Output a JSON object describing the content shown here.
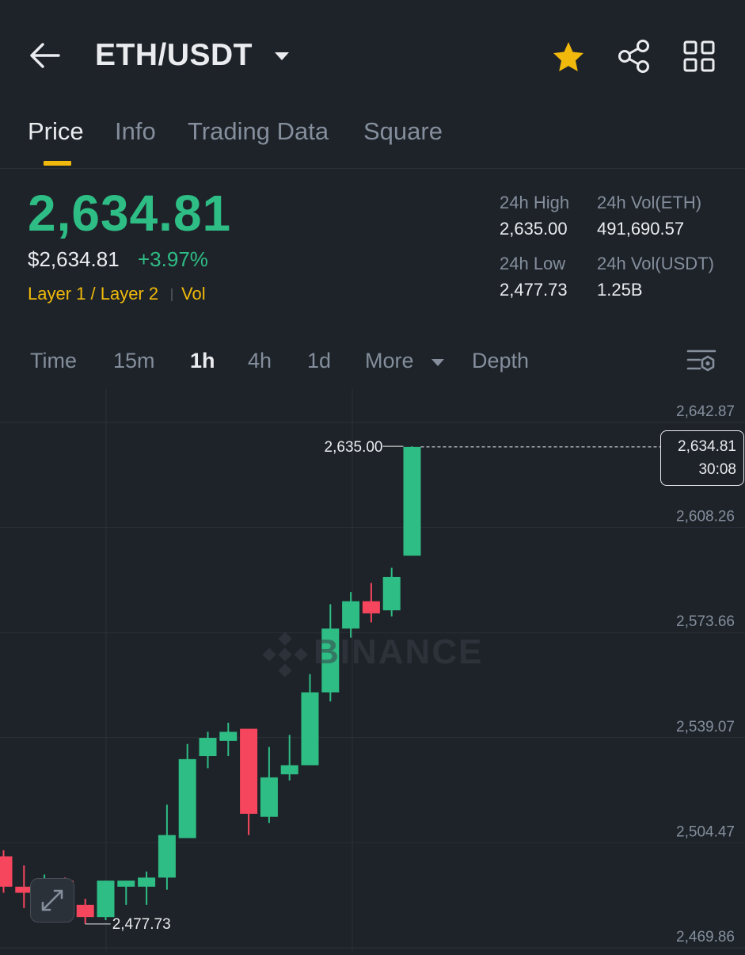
{
  "header": {
    "pair": "ETH/USDT",
    "icons": [
      "back-arrow",
      "caret-down",
      "star-favorite",
      "share",
      "grid-menu"
    ],
    "favorite_color": "#f0b90b"
  },
  "tabs": [
    {
      "label": "Price",
      "active": true
    },
    {
      "label": "Info",
      "active": false
    },
    {
      "label": "Trading Data",
      "active": false
    },
    {
      "label": "Square",
      "active": false
    }
  ],
  "price": {
    "last": "2,634.81",
    "usd": "$2,634.81",
    "change": "+3.97%",
    "tag1": "Layer 1 / Layer 2",
    "tag2": "Vol",
    "up_color": "#2ebd85",
    "down_color": "#f6465d"
  },
  "stats": {
    "high_label": "24h High",
    "high_value": "2,635.00",
    "low_label": "24h Low",
    "low_value": "2,477.73",
    "vol_base_label": "24h Vol(ETH)",
    "vol_base_value": "491,690.57",
    "vol_quote_label": "24h Vol(USDT)",
    "vol_quote_value": "1.25B"
  },
  "intervals": [
    {
      "label": "Time",
      "active": false
    },
    {
      "label": "15m",
      "active": false
    },
    {
      "label": "1h",
      "active": true
    },
    {
      "label": "4h",
      "active": false
    },
    {
      "label": "1d",
      "active": false
    },
    {
      "label": "More",
      "active": false
    },
    {
      "label": "Depth",
      "active": false
    }
  ],
  "chart_data": {
    "type": "candlestick",
    "interval": "1h",
    "y_ticks": [
      "2,642.87",
      "2,608.26",
      "2,573.66",
      "2,539.07",
      "2,504.47",
      "2,469.86"
    ],
    "ylim": [
      2469.86,
      2642.87
    ],
    "grid": true,
    "watermark": "BINANCE",
    "high_marker": "2,635.00",
    "low_marker": "2,477.73",
    "current_price": "2,634.81",
    "countdown": "30:08",
    "candles": [
      {
        "o": 2500.0,
        "h": 2502.0,
        "l": 2488.0,
        "c": 2490.0
      },
      {
        "o": 2490.0,
        "h": 2497.0,
        "l": 2483.0,
        "c": 2488.0
      },
      {
        "o": 2488.0,
        "h": 2494.0,
        "l": 2487.0,
        "c": 2492.0
      },
      {
        "o": 2492.0,
        "h": 2493.0,
        "l": 2481.0,
        "c": 2484.0
      },
      {
        "o": 2484.0,
        "h": 2486.0,
        "l": 2477.73,
        "c": 2480.0
      },
      {
        "o": 2480.0,
        "h": 2492.0,
        "l": 2479.0,
        "c": 2492.0
      },
      {
        "o": 2490.0,
        "h": 2492.0,
        "l": 2484.0,
        "c": 2492.0
      },
      {
        "o": 2490.0,
        "h": 2495.0,
        "l": 2484.0,
        "c": 2493.0
      },
      {
        "o": 2493.0,
        "h": 2517.0,
        "l": 2489.0,
        "c": 2507.0
      },
      {
        "o": 2506.0,
        "h": 2537.0,
        "l": 2506.0,
        "c": 2532.0
      },
      {
        "o": 2533.0,
        "h": 2541.0,
        "l": 2529.0,
        "c": 2539.0
      },
      {
        "o": 2538.0,
        "h": 2544.0,
        "l": 2533.0,
        "c": 2541.0
      },
      {
        "o": 2542.0,
        "h": 2542.0,
        "l": 2507.0,
        "c": 2514.0
      },
      {
        "o": 2513.0,
        "h": 2536.0,
        "l": 2511.0,
        "c": 2526.0
      },
      {
        "o": 2527.0,
        "h": 2540.0,
        "l": 2525.0,
        "c": 2530.0
      },
      {
        "o": 2530.0,
        "h": 2560.0,
        "l": 2530.0,
        "c": 2554.0
      },
      {
        "o": 2554.0,
        "h": 2583.0,
        "l": 2551.0,
        "c": 2575.0
      },
      {
        "o": 2575.0,
        "h": 2587.0,
        "l": 2572.0,
        "c": 2584.0
      },
      {
        "o": 2584.0,
        "h": 2590.0,
        "l": 2577.0,
        "c": 2580.0
      },
      {
        "o": 2581.0,
        "h": 2595.0,
        "l": 2579.0,
        "c": 2592.0
      },
      {
        "o": 2599.0,
        "h": 2635.0,
        "l": 2599.0,
        "c": 2634.81
      }
    ]
  }
}
